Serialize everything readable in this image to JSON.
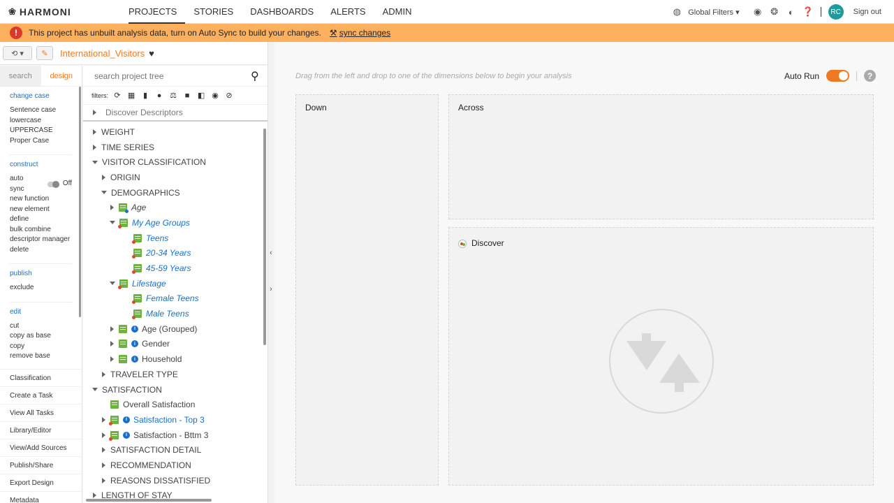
{
  "brand": "HARMONI",
  "nav": [
    "PROJECTS",
    "STORIES",
    "DASHBOARDS",
    "ALERTS",
    "ADMIN"
  ],
  "topright": {
    "global_filters": "Global Filters",
    "avatar": "RC",
    "sign_out": "Sign out"
  },
  "banner": {
    "message": "This project has unbuilt analysis data, turn on Auto Sync to build your changes.",
    "sync": "sync changes"
  },
  "project": {
    "name": "International_Visitors"
  },
  "lefttabs": [
    "search",
    "design"
  ],
  "change_case": {
    "head": "change case",
    "items": [
      "Sentence case",
      "lowercase",
      "UPPERCASE",
      "Proper Case"
    ]
  },
  "construct": {
    "head": "construct",
    "auto_sync": "auto sync",
    "auto_sync_state": "Off",
    "items": [
      "new function",
      "new element",
      "define",
      "bulk combine",
      "descriptor manager",
      "delete"
    ]
  },
  "publish": {
    "head": "publish",
    "items": [
      "exclude"
    ]
  },
  "edit": {
    "head": "edit",
    "items": [
      "cut",
      "copy as base",
      "copy",
      "remove base"
    ]
  },
  "left_links": [
    "Classification",
    "Create a Task",
    "View All Tasks",
    "Library/Editor",
    "View/Add Sources",
    "Publish/Share",
    "Export Design",
    "Metadata"
  ],
  "tree_search": {
    "placeholder": "search project tree"
  },
  "filters_label": "filters:",
  "discover_descriptors": "Discover Descriptors",
  "tree": [
    "WEIGHT",
    "TIME SERIES",
    "VISITOR CLASSIFICATION",
    "ORIGIN",
    "DEMOGRAPHICS",
    "Age",
    "My Age Groups",
    "Teens",
    "20-34 Years",
    "45-59 Years",
    "Lifestage",
    "Female Teens",
    "Male Teens",
    "Age (Grouped)",
    "Gender",
    "Household",
    "TRAVELER TYPE",
    "SATISFACTION",
    "Overall Satisfaction",
    "Satisfaction - Top 3",
    "Satisfaction - Bttm 3",
    "SATISFACTION DETAIL",
    "RECOMMENDATION",
    "REASONS DISSATISFIED",
    "LENGTH OF STAY"
  ],
  "main": {
    "hint": "Drag from the left and drop to one of the dimensions below to begin your analysis",
    "auto_run": "Auto Run",
    "down": "Down",
    "across": "Across",
    "discover": "Discover"
  },
  "colors": {
    "accent": "#f07a22",
    "banner": "#fdb15e",
    "link": "#1a6fc9",
    "green_icon": "#6cb33f"
  }
}
